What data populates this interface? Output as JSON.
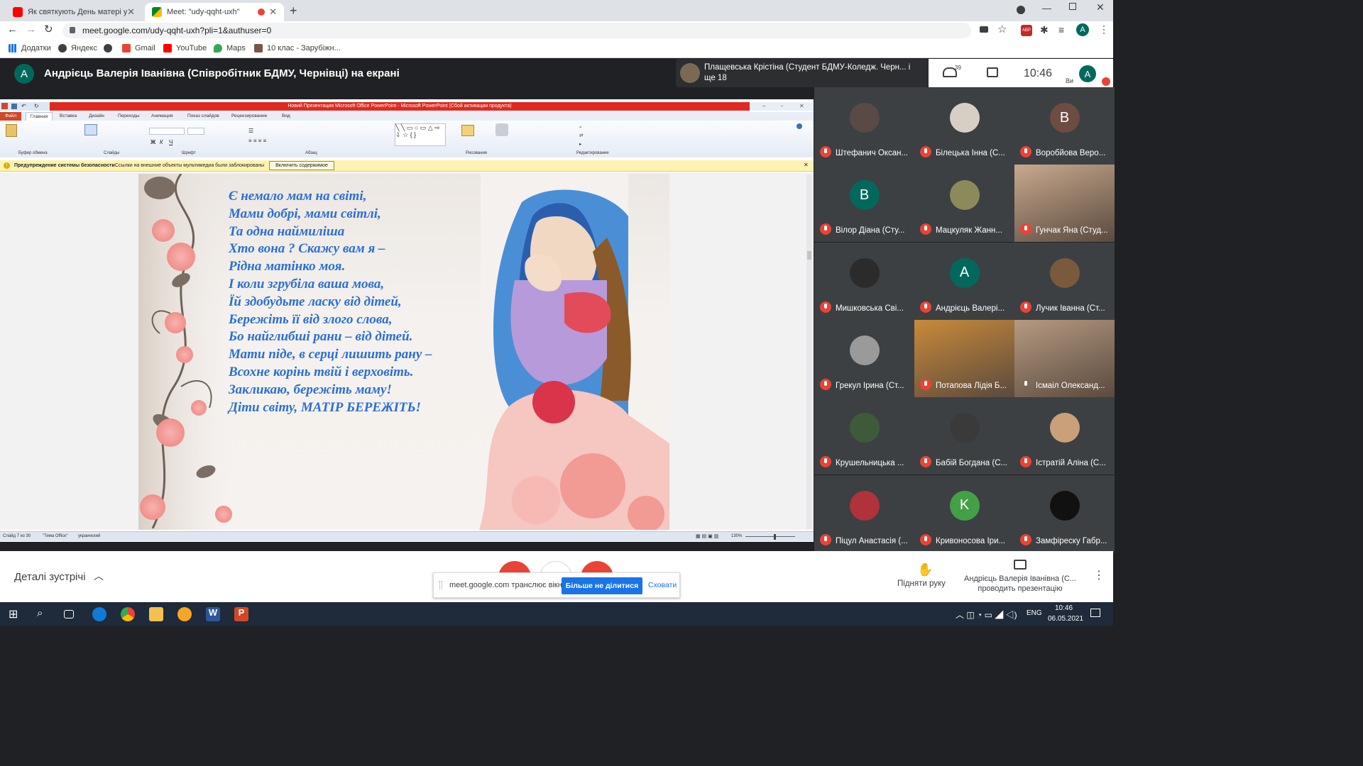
{
  "browser": {
    "tabs": [
      {
        "title": "Як святкують День матері у різ",
        "active": false
      },
      {
        "title": "Meet: \"udy-qqht-uxh\"",
        "active": true
      }
    ],
    "url": "meet.google.com/udy-qqht-uxh?pli=1&authuser=0",
    "bookmarks": [
      "Додатки",
      "Яндекс",
      "Gmail",
      "YouTube",
      "Maps",
      "10 клас - Зарубіжн..."
    ],
    "account_letter": "A"
  },
  "meet": {
    "presenter_avatar": "A",
    "presenter_text": "Андрієць Валерія Іванівна (Співробітник БДМУ, Чернівці) на екрані",
    "pinned_text": "Плащевська Крістіна (Студент БДМУ-Коледж. Черн... і ще 18",
    "participants_count": "39",
    "time": "10:46",
    "self_avatar": "A",
    "self_label": "Ви",
    "details_label": "Деталі зустрічі",
    "raise_hand_label": "Підняти руку",
    "presenting_label": "Андрієць Валерія Іванівна (С... проводить презентацію",
    "share_bar": {
      "text": "meet.google.com транслює вікно.",
      "stop_label": "Більше не ділитися",
      "hide_label": "Сховати"
    }
  },
  "participants": [
    {
      "name": "Штефанич Оксан...",
      "avatar": "",
      "color": "#5a4a46"
    },
    {
      "name": "Білецька Інна (С...",
      "avatar": "",
      "color": "#d8cfc4"
    },
    {
      "name": "Воробйова Веро...",
      "avatar": "B",
      "color": "#6d4c41"
    },
    {
      "name": "Вілор Діана (Сту...",
      "avatar": "B",
      "color": "#00695c"
    },
    {
      "name": "Мацкуляк Жанн...",
      "avatar": "",
      "color": "#8c8a5a"
    },
    {
      "name": "Гунчак Яна (Студ...",
      "avatar": "",
      "color": "#c8a98e"
    },
    {
      "name": "Мишковська Сві...",
      "avatar": "",
      "color": "#2b2b2b"
    },
    {
      "name": "Андрієць Валері...",
      "avatar": "A",
      "color": "#00695c"
    },
    {
      "name": "Лучик Іванна (Ст...",
      "avatar": "",
      "color": "#7a5a3c"
    },
    {
      "name": "Грекул Ірина (Ст...",
      "avatar": "",
      "color": "#9a9a9a"
    },
    {
      "name": "Потапова Лідія Б...",
      "avatar": "",
      "color": "#c98a3a"
    },
    {
      "name": "Ісмаіл Олександ...",
      "avatar": "",
      "color": "#b59a82"
    },
    {
      "name": "Крушельницька ...",
      "avatar": "",
      "color": "#3f5a3a"
    },
    {
      "name": "Бабій Богдана (С...",
      "avatar": "",
      "color": "#3a3a3a"
    },
    {
      "name": "Істратій Аліна (С...",
      "avatar": "",
      "color": "#c9a07a"
    },
    {
      "name": "Піцул Анастасія (...",
      "avatar": "",
      "color": "#b0323a"
    },
    {
      "name": "Кривоносова Іри...",
      "avatar": "K",
      "color": "#43a047"
    },
    {
      "name": "Замфіреску Габр...",
      "avatar": "",
      "color": "#111111"
    }
  ],
  "powerpoint": {
    "title": "Новий Презентация Microsoft Office PowerPoint - Microsoft PowerPoint (Сбой активации продукта)",
    "tabs": [
      "Файл",
      "Главная",
      "Вставка",
      "Дизайн",
      "Переходы",
      "Анимация",
      "Показ слайдов",
      "Рецензирование",
      "Вид"
    ],
    "groups": [
      "Буфер обмена",
      "Слайды",
      "Шрифт",
      "Абзац",
      "Рисование",
      "Редактирование"
    ],
    "warning_title": "Предупреждение системы безопасности",
    "warning_text": "Ссылки на внешние объекты мультимедиа были заблокированы",
    "warning_button": "Включить содержимое",
    "status_slide": "Слайд 7 из 30",
    "status_theme": "\"Тема Office\"",
    "status_lang": "украинский",
    "zoom": "130%"
  },
  "poem": [
    "Є немало мам на світі,",
    "Мами добрі, мами світлі,",
    "Та одна наймиліша",
    "Хто вона ? Скажу вам я –",
    "Рідна матінко моя.",
    "І коли згрубіла ваша мова,",
    "Їй здобудьте ласку від дітей,",
    "Бережіть її від злого слова,",
    "Бо найглибші рани – від дітей.",
    "Мати піде, в серці лишить рану –",
    "Всохне корінь твій і верховіть.",
    "Закликаю, бережіть маму!",
    "Діти світу, МАТІР БЕРЕЖІТЬ!"
  ],
  "taskbar": {
    "lang": "ENG",
    "time": "10:46",
    "date": "06.05.2021"
  }
}
